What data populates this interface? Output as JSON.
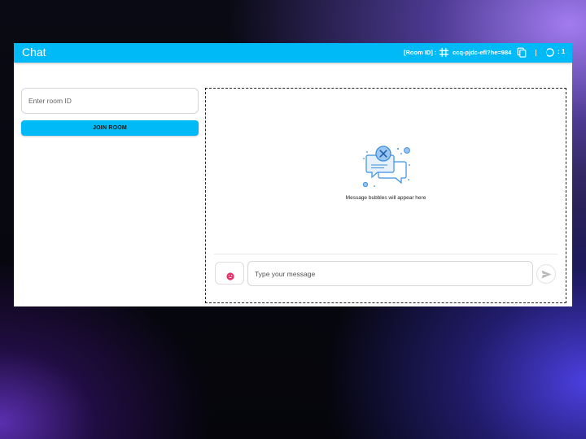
{
  "app": {
    "title": "Chat"
  },
  "header": {
    "room_label": "[Room ID] :",
    "room_id": "ccq-pjdc-efl?he=984",
    "user_count": ": 1",
    "icons": [
      "hash-icon",
      "copy-icon",
      "connection-icon"
    ]
  },
  "join": {
    "placeholder": "Enter room ID",
    "button_label": "JOIN ROOM"
  },
  "chat": {
    "empty_text": "Message bubbles will appear here",
    "message_placeholder": "Type your message",
    "icons": [
      "emoji-icon",
      "send-icon",
      "empty-messages-icon"
    ]
  },
  "colors": {
    "primary": "#00b9f7",
    "emoji": "#e8336d",
    "illustration": "#3b8fe0"
  }
}
